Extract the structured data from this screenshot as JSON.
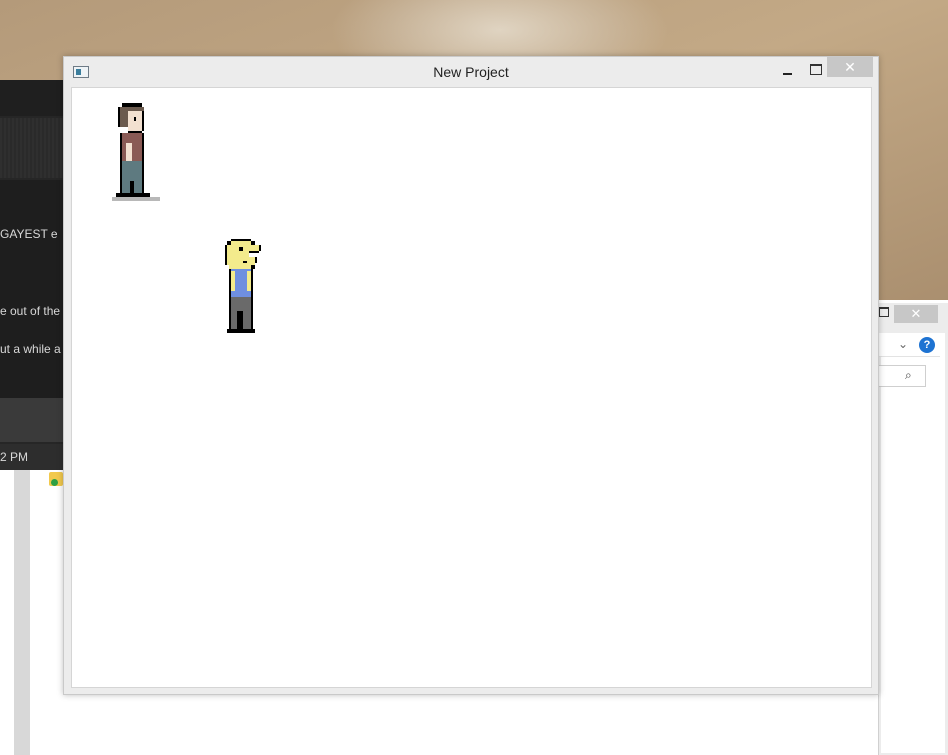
{
  "window": {
    "title": "New Project",
    "close_glyph": "✕"
  },
  "background_chat": {
    "line1": "GAYEST e",
    "line2": "e out of the",
    "line3": "ut a while a",
    "timestamp": "2 PM"
  },
  "background_explorer": {
    "help_glyph": "?",
    "chevron_glyph": "⌄",
    "search_glyph": "⌕",
    "close_glyph": "✕"
  },
  "sprites": {
    "human": {
      "name": "human-character-sprite",
      "hair": "#6b5a4e",
      "shirt": "#8a5a55",
      "pants": "#5e7a80",
      "skin": "#f2e0d0"
    },
    "pacman": {
      "name": "pacman-character-sprite",
      "head": "#f3eb8c",
      "shirt": "#6f8fe0",
      "pants": "#6a6a6a"
    }
  }
}
